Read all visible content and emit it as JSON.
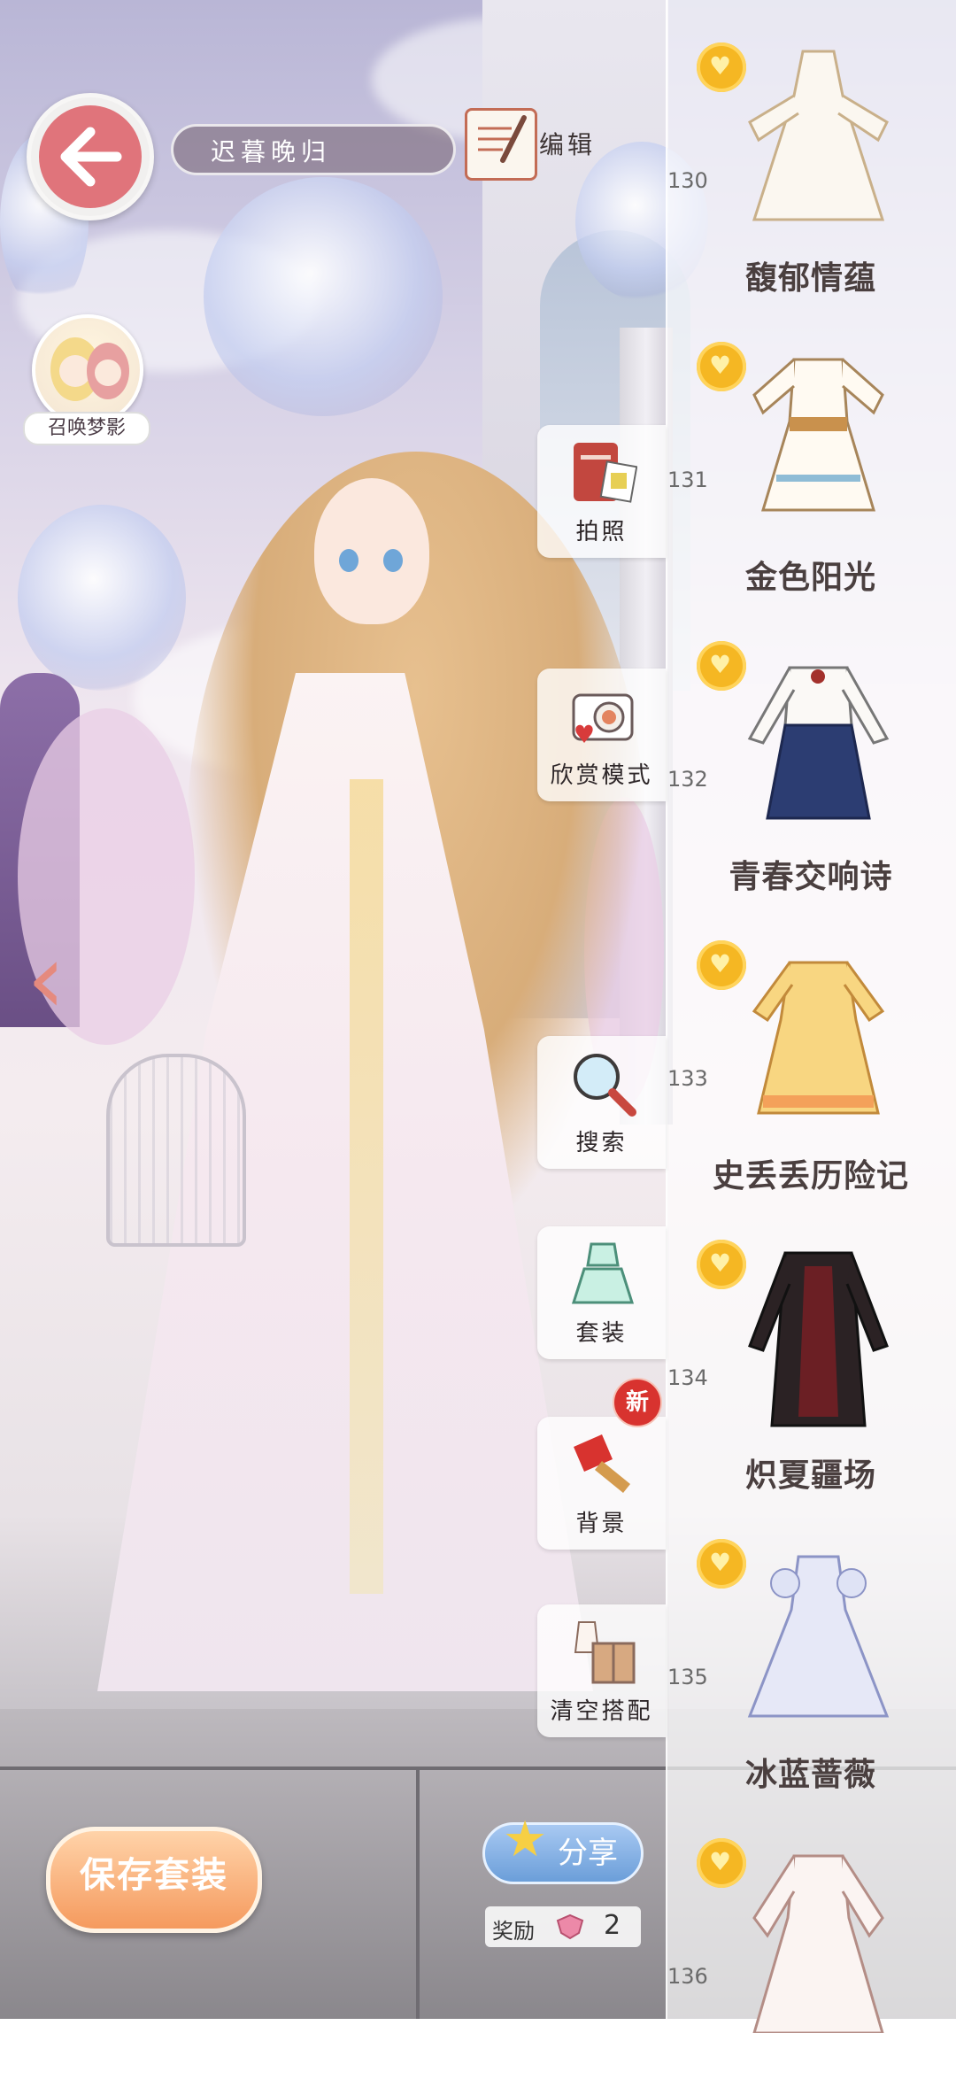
{
  "header": {
    "outfit_name": "迟暮晚归",
    "edit_label": "编辑"
  },
  "summon": {
    "label": "召唤梦影"
  },
  "tools": [
    {
      "label": "拍照",
      "icon": "photo-album-icon"
    },
    {
      "label": "欣赏模式",
      "icon": "camera-icon"
    },
    {
      "label": "搜索",
      "icon": "magnifier-icon"
    },
    {
      "label": "套装",
      "icon": "outfit-icon"
    },
    {
      "label": "背景",
      "icon": "paintbrush-icon"
    },
    {
      "label": "清空搭配",
      "icon": "clear-box-icon"
    }
  ],
  "new_badge": "新",
  "outfit_list": [
    {
      "number": "130",
      "name": "馥郁情蕴"
    },
    {
      "number": "131",
      "name": "金色阳光"
    },
    {
      "number": "132",
      "name": "青春交响诗"
    },
    {
      "number": "133",
      "name": "史丢丢历险记"
    },
    {
      "number": "134",
      "name": "炽夏疆场"
    },
    {
      "number": "135",
      "name": "冰蓝蔷薇"
    },
    {
      "number": "136",
      "name": ""
    }
  ],
  "bottom": {
    "save_label": "保存套装",
    "share_label": "分享",
    "reward_label": "奖励",
    "reward_count": "2"
  },
  "colors": {
    "back_button": "#e0747b",
    "medal": "#f5b723",
    "save_button": "#f59a5e",
    "share_button": "#6b9ed9",
    "new_badge": "#d8332f"
  }
}
